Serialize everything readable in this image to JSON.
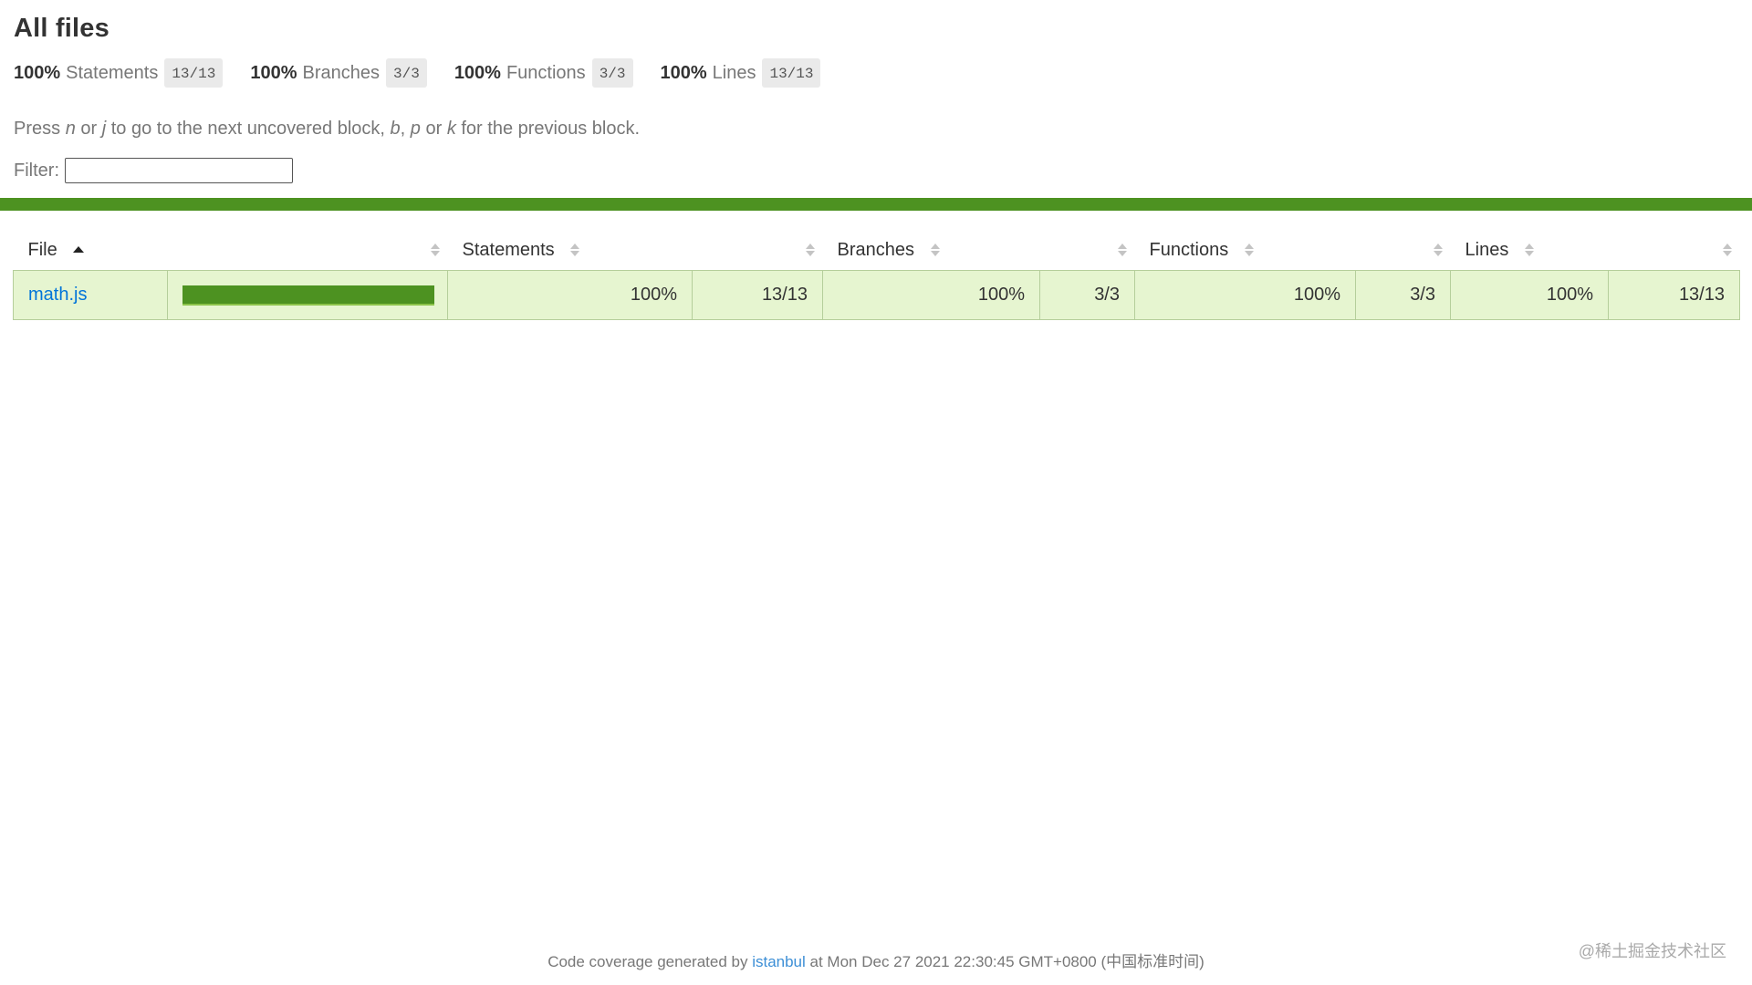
{
  "header": {
    "title": "All files"
  },
  "summary": [
    {
      "pct": "100%",
      "label": "Statements",
      "fraction": "13/13"
    },
    {
      "pct": "100%",
      "label": "Branches",
      "fraction": "3/3"
    },
    {
      "pct": "100%",
      "label": "Functions",
      "fraction": "3/3"
    },
    {
      "pct": "100%",
      "label": "Lines",
      "fraction": "13/13"
    }
  ],
  "hint": {
    "press": "Press",
    "n": "n",
    "or1": "or",
    "j": "j",
    "mid": "to go to the next uncovered block,",
    "b": "b",
    "comma": ",",
    "p": "p",
    "or2": "or",
    "k": "k",
    "end": "for the previous block."
  },
  "filter": {
    "label": "Filter:",
    "value": ""
  },
  "table": {
    "headers": {
      "file": "File",
      "statements": "Statements",
      "branches": "Branches",
      "functions": "Functions",
      "lines": "Lines"
    },
    "rows": [
      {
        "file": "math.js",
        "coverage_fill": 1.0,
        "statements_pct": "100%",
        "statements_frac": "13/13",
        "branches_pct": "100%",
        "branches_frac": "3/3",
        "functions_pct": "100%",
        "functions_frac": "3/3",
        "lines_pct": "100%",
        "lines_frac": "13/13"
      }
    ]
  },
  "colors": {
    "status_high": "#4d9221",
    "row_high_bg": "#e6f5d0",
    "link": "#0074d9"
  },
  "footer": {
    "prefix": "Code coverage generated by",
    "link": "istanbul",
    "suffix": "at Mon Dec 27 2021 22:30:45 GMT+0800 (中国标准时间)"
  },
  "watermark": "@稀土掘金技术社区"
}
